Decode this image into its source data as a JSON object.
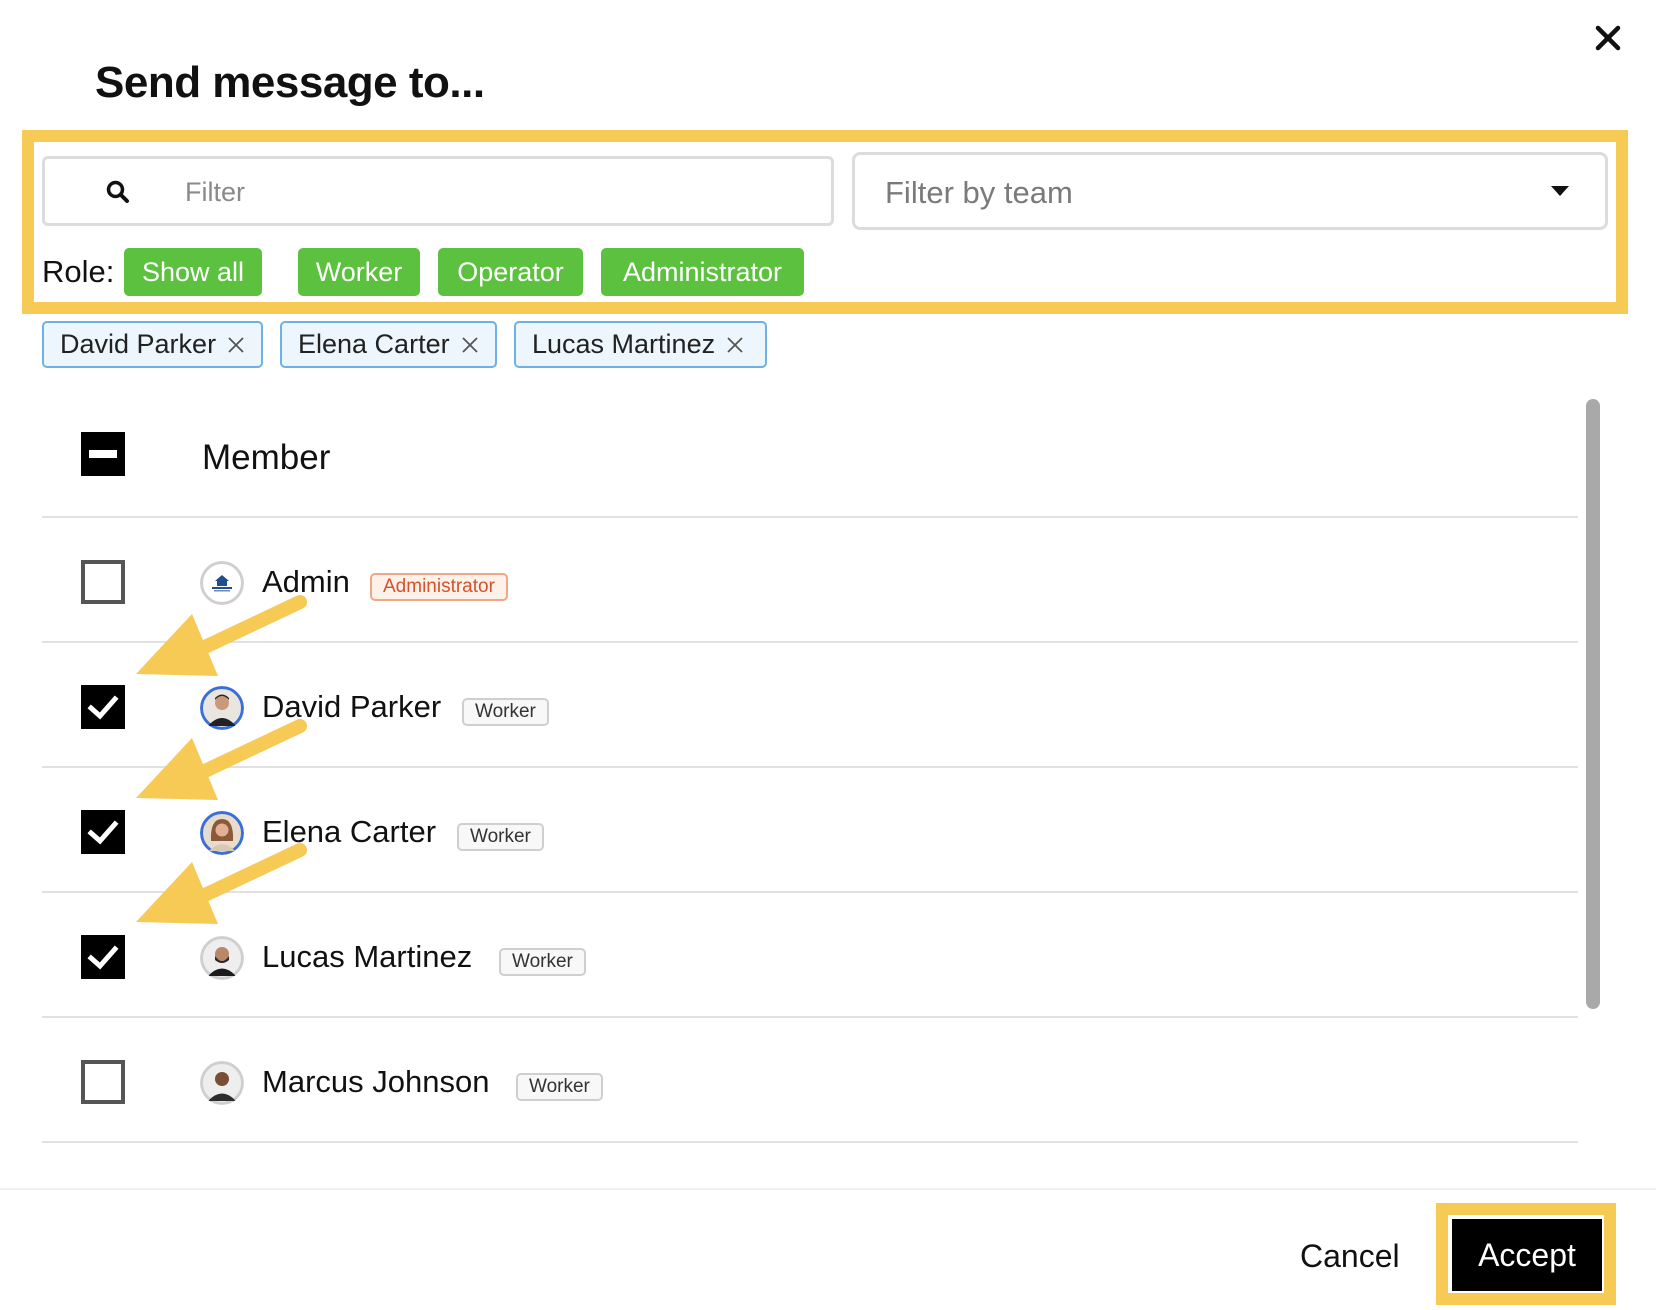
{
  "dialog": {
    "title": "Send message to...",
    "close_icon": "close-icon"
  },
  "filters": {
    "search_placeholder": "Filter",
    "team_placeholder": "Filter by team",
    "role_label": "Role:",
    "roles": [
      "Show all",
      "Worker",
      "Operator",
      "Administrator"
    ]
  },
  "selected": [
    "David Parker",
    "Elena Carter",
    "Lucas Martinez"
  ],
  "table": {
    "header": "Member",
    "rows": [
      {
        "name": "Admin",
        "role": "Administrator",
        "checked": false
      },
      {
        "name": "David Parker",
        "role": "Worker",
        "checked": true
      },
      {
        "name": "Elena Carter",
        "role": "Worker",
        "checked": true
      },
      {
        "name": "Lucas Martinez",
        "role": "Worker",
        "checked": true
      },
      {
        "name": "Marcus Johnson",
        "role": "Worker",
        "checked": false
      }
    ]
  },
  "footer": {
    "cancel": "Cancel",
    "accept": "Accept"
  },
  "colors": {
    "highlight": "#f7c955",
    "role_chip": "#5cc13e",
    "tag_border": "#6fb0e6",
    "admin_badge": "#d4532b"
  }
}
